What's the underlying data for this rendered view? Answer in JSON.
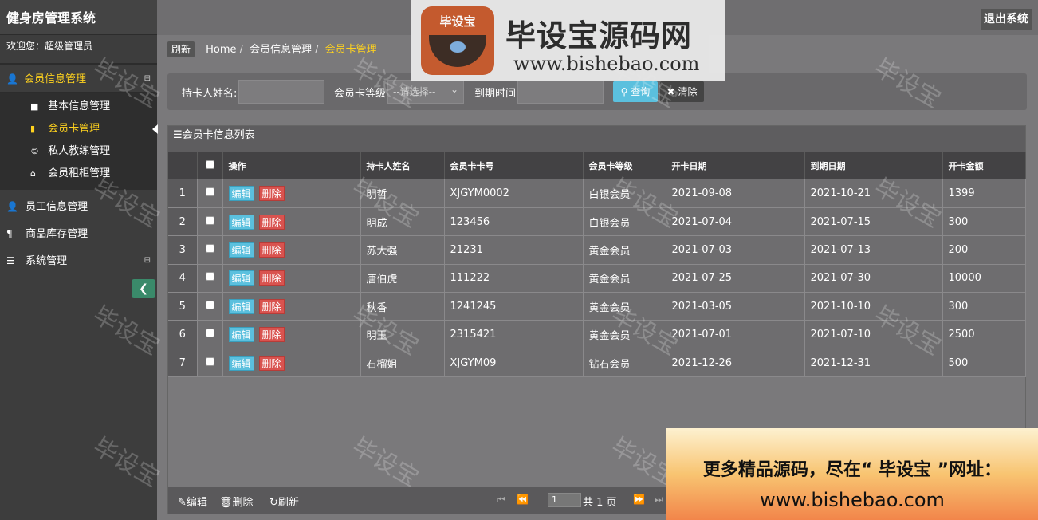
{
  "app": {
    "title": "健身房管理系统",
    "welcome": "欢迎您：超级管理员",
    "logout_label": "退出系统"
  },
  "sidebar": {
    "groups": [
      {
        "label": "会员信息管理",
        "icon": "user-icon",
        "active": true,
        "items": [
          {
            "label": "基本信息管理",
            "icon": "folder-icon"
          },
          {
            "label": "会员卡管理",
            "icon": "book-icon",
            "active": true
          },
          {
            "label": "私人教练管理",
            "icon": "copyright-icon"
          },
          {
            "label": "会员租柜管理",
            "icon": "home-icon"
          }
        ]
      },
      {
        "label": "员工信息管理",
        "icon": "user-icon"
      },
      {
        "label": "商品库存管理",
        "icon": "cutlery-icon"
      },
      {
        "label": "系统管理",
        "icon": "list-icon"
      }
    ]
  },
  "breadcrumb": {
    "refresh_label": "刷新",
    "items": [
      "Home",
      "会员信息管理",
      "会员卡管理"
    ]
  },
  "search": {
    "name_label": "持卡人姓名:",
    "name_value": "",
    "level_label": "会员卡等级",
    "level_selected": "--请选择--",
    "expiry_label": "到期时间",
    "expiry_value": "",
    "query_label": "查询",
    "clear_label": "清除"
  },
  "grid": {
    "title": "会员卡信息列表",
    "columns": [
      "操作",
      "持卡人姓名",
      "会员卡卡号",
      "会员卡等级",
      "开卡日期",
      "到期日期",
      "开卡金额"
    ],
    "edit_label": "编辑",
    "delete_label": "删除",
    "rows": [
      {
        "num": "1",
        "name": "明哲",
        "card_no": "XJGYM0002",
        "level": "白银会员",
        "open_date": "2021-09-08",
        "expire_date": "2021-10-21",
        "amount": "1399"
      },
      {
        "num": "2",
        "name": "明成",
        "card_no": "123456",
        "level": "白银会员",
        "open_date": "2021-07-04",
        "expire_date": "2021-07-15",
        "amount": "300"
      },
      {
        "num": "3",
        "name": "苏大强",
        "card_no": "21231",
        "level": "黄金会员",
        "open_date": "2021-07-03",
        "expire_date": "2021-07-13",
        "amount": "200"
      },
      {
        "num": "4",
        "name": "唐伯虎",
        "card_no": "111222",
        "level": "黄金会员",
        "open_date": "2021-07-25",
        "expire_date": "2021-07-30",
        "amount": "10000"
      },
      {
        "num": "5",
        "name": "秋香",
        "card_no": "1241245",
        "level": "黄金会员",
        "open_date": "2021-03-05",
        "expire_date": "2021-10-10",
        "amount": "300"
      },
      {
        "num": "6",
        "name": "明玉",
        "card_no": "2315421",
        "level": "黄金会员",
        "open_date": "2021-07-01",
        "expire_date": "2021-07-10",
        "amount": "2500"
      },
      {
        "num": "7",
        "name": "石榴姐",
        "card_no": "XJGYM09",
        "level": "钻石会员",
        "open_date": "2021-12-26",
        "expire_date": "2021-12-31",
        "amount": "500"
      }
    ]
  },
  "pager": {
    "edit_label": "编辑",
    "delete_label": "删除",
    "refresh_label": "刷新",
    "page_value": "1",
    "total_text": "共 1 页"
  },
  "overlays": {
    "logo_badge": "毕设宝",
    "logo_title": "毕设宝源码网",
    "logo_url": "www.bishebao.com",
    "ad_line1": "更多精品源码，尽在“ 毕设宝 ”网址：",
    "ad_line2": "www.bishebao.com",
    "watermark": "毕设宝"
  },
  "colors": {
    "accent": "#ffd21e",
    "edit": "#5bc0de",
    "delete": "#d9534f"
  }
}
